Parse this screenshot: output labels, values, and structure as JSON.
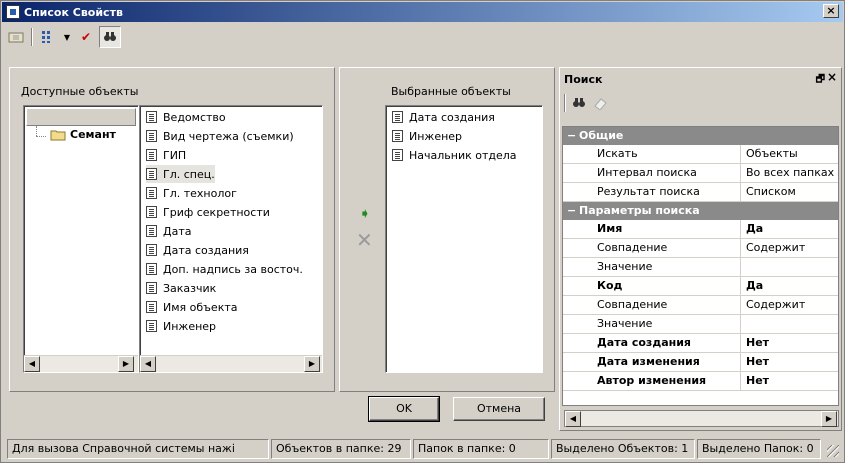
{
  "window": {
    "title": "Список Свойств",
    "close_label": "×"
  },
  "toolbar": {
    "dropdown_arrow": "▼",
    "check": "✔",
    "binoculars": "🔍"
  },
  "left_panel": {
    "label": "Доступные объекты",
    "tree": {
      "folder_label": "Семант"
    },
    "items": [
      "Ведомство",
      "Вид чертежа (съемки)",
      "ГИП",
      "Гл. спец.",
      "Гл. технолог",
      "Гриф секретности",
      "Дата",
      "Дата создания",
      "Доп. надпись за восточ.",
      "Заказчик",
      "Имя объекта",
      "Инженер"
    ],
    "selected_index": 3
  },
  "middle": {
    "add_icon": "➧",
    "remove_icon": "✕"
  },
  "right_list": {
    "label": "Выбранные объекты",
    "items": [
      "Дата создания",
      "Инженер",
      "Начальник отдела"
    ]
  },
  "buttons": {
    "ok": "OK",
    "cancel": "Отмена"
  },
  "find_panel": {
    "title": "Поиск",
    "pin": "🗗",
    "close": "×",
    "categories": [
      {
        "name": "Общие",
        "rows": [
          {
            "key": "Искать",
            "value": "Объекты",
            "bold": false
          },
          {
            "key": "Интервал поиска",
            "value": "Во всех папках",
            "bold": false
          },
          {
            "key": "Результат поиска",
            "value": "Списком",
            "bold": false
          }
        ]
      },
      {
        "name": "Параметры поиска",
        "rows": [
          {
            "key": "Имя",
            "value": "Да",
            "bold": true
          },
          {
            "key": "Совпадение",
            "value": "Содержит",
            "bold": false
          },
          {
            "key": "Значение",
            "value": "",
            "bold": false
          },
          {
            "key": "Код",
            "value": "Да",
            "bold": true
          },
          {
            "key": "Совпадение",
            "value": "Содержит",
            "bold": false
          },
          {
            "key": "Значение",
            "value": "",
            "bold": false
          },
          {
            "key": "Дата создания",
            "value": "Нет",
            "bold": true
          },
          {
            "key": "Дата изменения",
            "value": "Нет",
            "bold": true
          },
          {
            "key": "Автор изменения",
            "value": "Нет",
            "bold": true
          }
        ]
      }
    ]
  },
  "status": {
    "help": "Для вызова Справочной системы нажі",
    "objects_in_folder": "Объектов в папке: 29",
    "folders_in_folder": "Папок в папке: 0",
    "selected_objects": "Выделено Объектов: 1",
    "selected_folders": "Выделено Папок: 0"
  }
}
